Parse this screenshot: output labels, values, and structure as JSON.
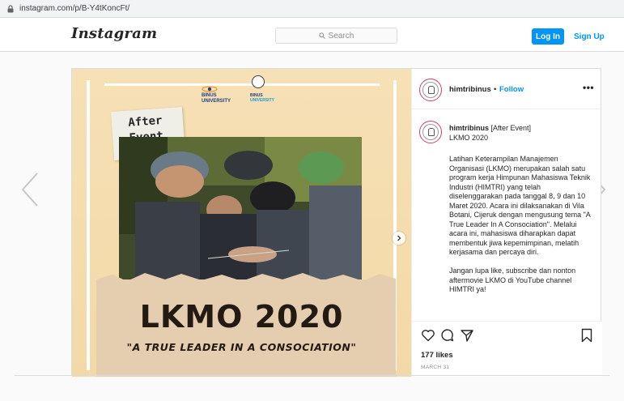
{
  "browser": {
    "url": "instagram.com/p/B-Y4tKoncFt/"
  },
  "nav": {
    "logo": "Instagram",
    "search_placeholder": "Search",
    "login_label": "Log In",
    "signup_label": "Sign Up"
  },
  "post": {
    "image": {
      "after_event": [
        "After",
        "Event"
      ],
      "logo_text_1": [
        "BINUS",
        "UNIVERSITY"
      ],
      "logo_text_2": [
        "BINUS",
        "UNIVERSITY"
      ],
      "headline": "LKMO 2020",
      "tagline": "\"A TRUE LEADER IN A CONSOCIATION\""
    },
    "header": {
      "username": "himtribinus",
      "separator": "•",
      "follow_label": "Follow",
      "more_label": "•••"
    },
    "caption": {
      "username": "himtribinus",
      "first_line": "[After Event]",
      "second_line": "LKMO 2020",
      "paragraphs": [
        "Latihan Keterampilan Manajemen Organisasi (LKMO) merupakan salah satu program kerja Himpunan Mahasiswa Teknik Industri (HIMTRI) yang telah diselenggarakan pada tanggal 8, 9 dan 10 Maret 2020. Acara ini dilaksanakan di Vila Botani, Cijeruk dengan mengusung tema \"A True Leader In A Consociation\". Melalui acara ini, mahasiswa diharapkan dapat membentuk jiwa kepemimpinan, melatih kerjasama dan percaya diri.",
        "Jangan lupa like, subscribe dan nonton aftermovie LKMO di YouTube channel HIMTRI ya!"
      ]
    },
    "likes": "177 likes",
    "date": "MARCH 31"
  },
  "icons": {
    "lock": "lock-icon",
    "search": "search-icon",
    "heart": "heart-icon",
    "comment": "comment-icon",
    "share": "share-icon",
    "bookmark": "bookmark-icon",
    "prev": "chevron-left-icon",
    "next": "chevron-right-icon"
  },
  "colors": {
    "accent": "#0095f6",
    "poster_bg": "#f6e0b5",
    "ring": "#d63a6e"
  }
}
